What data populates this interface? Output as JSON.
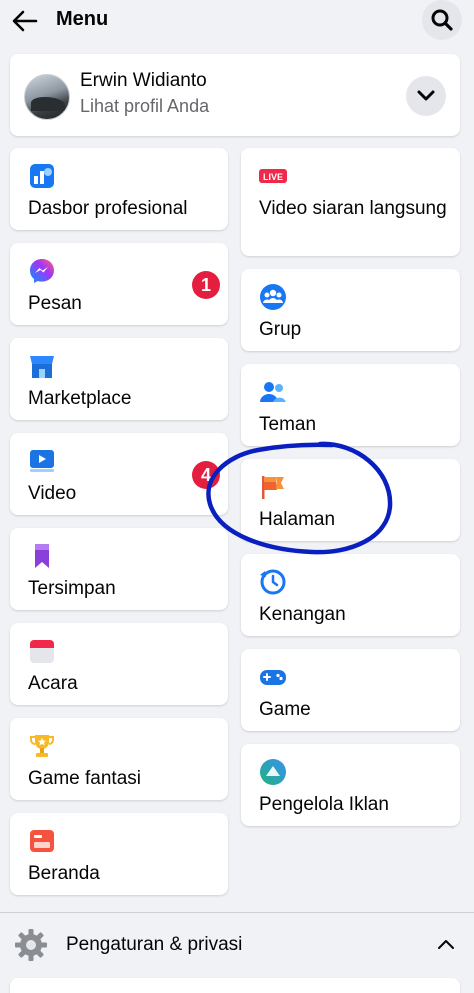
{
  "header": {
    "title": "Menu"
  },
  "profile": {
    "name": "Erwin Widianto",
    "subtitle": "Lihat profil Anda"
  },
  "left_column": [
    {
      "label": "Dasbor profesional",
      "icon": "professional-dashboard-icon"
    },
    {
      "label": "Pesan",
      "icon": "messenger-icon",
      "badge": "1"
    },
    {
      "label": "Marketplace",
      "icon": "marketplace-icon"
    },
    {
      "label": "Video",
      "icon": "video-icon",
      "badge": "4"
    },
    {
      "label": "Tersimpan",
      "icon": "bookmark-icon"
    },
    {
      "label": "Acara",
      "icon": "calendar-icon"
    },
    {
      "label": "Game fantasi",
      "icon": "trophy-icon"
    },
    {
      "label": "Beranda",
      "icon": "feeds-icon"
    }
  ],
  "right_column": [
    {
      "label": "Video siaran langsung",
      "icon": "live-icon",
      "icon_text": "LIVE"
    },
    {
      "label": "Grup",
      "icon": "groups-icon"
    },
    {
      "label": "Teman",
      "icon": "friends-icon"
    },
    {
      "label": "Halaman",
      "icon": "pages-flag-icon"
    },
    {
      "label": "Kenangan",
      "icon": "memories-icon"
    },
    {
      "label": "Game",
      "icon": "gamepad-icon"
    },
    {
      "label": "Pengelola Iklan",
      "icon": "ads-manager-icon"
    }
  ],
  "settings": {
    "label": "Pengaturan & privasi",
    "icon": "gear-icon"
  },
  "colors": {
    "background": "#f0f2f5",
    "card": "#ffffff",
    "badge": "#e41e3f",
    "secondary_text": "#65676b",
    "annotation": "#0a1fbf"
  }
}
